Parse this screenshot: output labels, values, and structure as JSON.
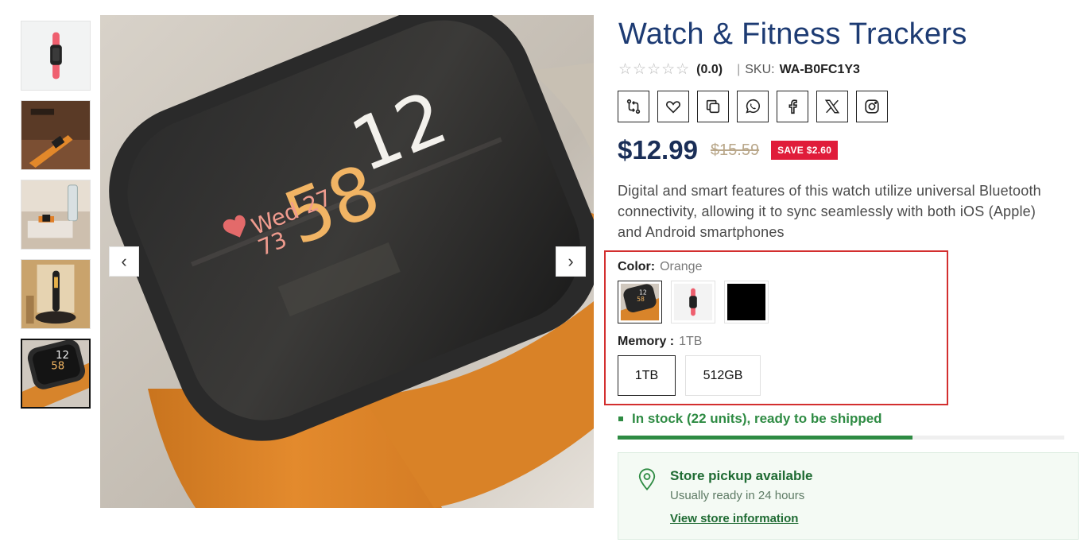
{
  "product": {
    "title": "Watch & Fitness Trackers",
    "rating_stars": "☆☆☆☆☆",
    "rating_value": "(0.0)",
    "sku_separator": "|",
    "sku_label": "SKU:",
    "sku": "WA-B0FC1Y3",
    "price": "$12.99",
    "old_price": "$15.59",
    "save_badge": "SAVE $2.60",
    "description": "Digital and smart features of this watch utilize universal Bluetooth connectivity, allowing it to sync seamlessly with both iOS (Apple) and Android smartphones"
  },
  "gallery": {
    "thumbnails": [
      "thumbnail-1",
      "thumbnail-2",
      "thumbnail-3",
      "thumbnail-4",
      "thumbnail-5"
    ],
    "active_index": 5,
    "main_image_text": {
      "hour": "12",
      "minute": "58",
      "date": "Wed 27",
      "heart": "73"
    },
    "prev_arrow": "‹",
    "next_arrow": "›"
  },
  "share_icons": [
    "compare-icon",
    "heart-icon",
    "copy-icon",
    "whatsapp-icon",
    "facebook-icon",
    "x-icon",
    "instagram-icon"
  ],
  "variants": {
    "color_label": "Color:",
    "color_value": "Orange",
    "colors": [
      "Orange",
      "Red",
      "Black"
    ],
    "memory_label": "Memory :",
    "memory_value": "1TB",
    "memory_options": [
      "1TB",
      "512GB"
    ]
  },
  "stock": {
    "text": "In stock (22 units), ready to be shipped",
    "level": 0.66,
    "color": "#2e8b43"
  },
  "pickup": {
    "title": "Store pickup available",
    "subtitle": "Usually ready in 24 hours",
    "link": "View store information"
  },
  "colors": {
    "title": "#1d3b73",
    "price": "#1a2e57",
    "save_badge": "#e01c3a",
    "highlight_border": "#d32f2f"
  }
}
